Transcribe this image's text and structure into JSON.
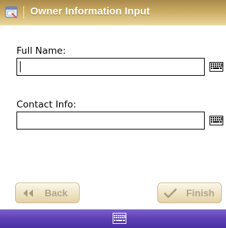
{
  "title_bar": {
    "title": "Owner Information Input",
    "icon": "app-window-icon"
  },
  "form": {
    "full_name": {
      "label": "Full Name:",
      "value": "",
      "keyboard_icon": "keyboard-icon"
    },
    "contact_info": {
      "label": "Contact Info:",
      "value": "",
      "keyboard_icon": "keyboard-icon"
    }
  },
  "buttons": {
    "back_label": "Back",
    "back_icon": "double-left-arrow-icon",
    "finish_label": "Finish",
    "finish_icon": "checkmark-icon"
  },
  "bottom_bar": {
    "input_panel_icon": "keyboard-icon"
  },
  "colors": {
    "title_bar": "#c9ab62",
    "button_text": "#b0a588",
    "bottom_bar": "#5a3eb2"
  }
}
